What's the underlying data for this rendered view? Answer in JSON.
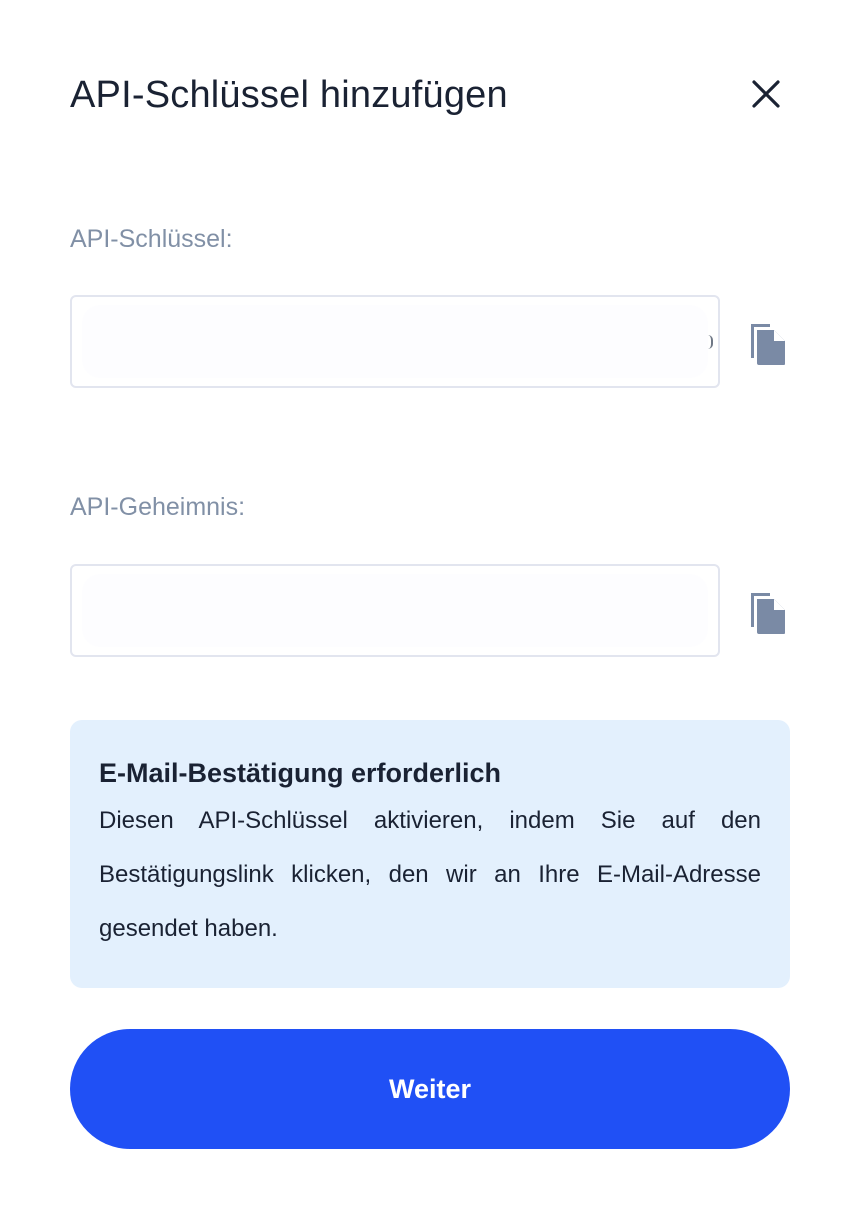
{
  "dialog": {
    "title": "API-Schlüssel hinzufügen",
    "close_icon": "close-icon"
  },
  "fields": {
    "api_key": {
      "label": "API-Schlüssel:",
      "value": "",
      "placeholder": "",
      "copy_icon": "copy-icon"
    },
    "api_secret": {
      "label": "API-Geheimnis:",
      "value": "",
      "placeholder": "",
      "copy_icon": "copy-icon"
    }
  },
  "notice": {
    "title": "E-Mail-Bestätigung erforderlich",
    "text": "Diesen API-Schlüssel aktivieren, indem Sie auf den Bestätigungslink klicken, den wir an Ihre E-Mail-Adresse gesendet haben."
  },
  "actions": {
    "continue_label": "Weiter"
  },
  "colors": {
    "primary": "#2050f5",
    "notice_bg": "#e3f0fd",
    "label": "#8190a6",
    "icon": "#7a8aa5",
    "text": "#1a2233"
  }
}
